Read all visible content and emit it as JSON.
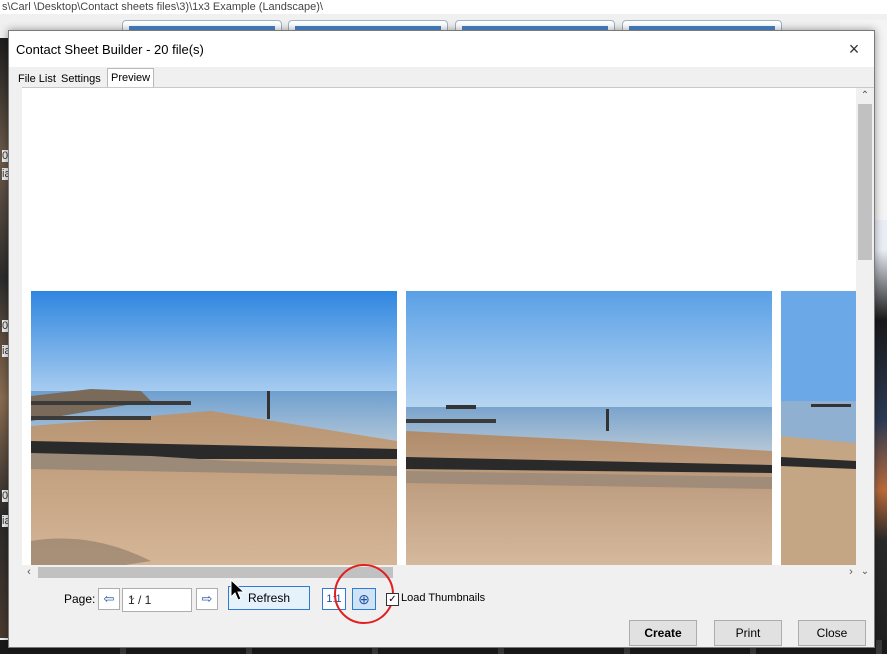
{
  "background": {
    "path_text": "s\\Carl \\Desktop\\Contact sheets files\\3)\\1x3 Example (Landscape)\\",
    "left_fragments": [
      "0",
      "ia",
      "0",
      "ia",
      "0",
      "ia"
    ]
  },
  "dialog": {
    "title": "Contact Sheet Builder - 20 file(s)",
    "close_glyph": "×"
  },
  "tabs": [
    {
      "label": "File List"
    },
    {
      "label": "Settings"
    },
    {
      "label": "Preview",
      "active": true
    }
  ],
  "controls": {
    "page_label": "Page:",
    "prev_glyph": "⇦",
    "next_glyph": "⇨",
    "page_value": "1 / 1",
    "refresh_label": "Refresh",
    "one_to_one_label": "1:1",
    "fit_glyph": "⊕",
    "load_thumbnails_label": "Load Thumbnails",
    "load_thumbnails_checked": "✓"
  },
  "footer": {
    "create_label": "Create",
    "print_label": "Print",
    "close_label": "Close"
  },
  "colors": {
    "accent": "#2e7bd6",
    "highlight_circle": "#e02020",
    "sky": "#3a8ee0",
    "sand": "#c9a27a"
  }
}
